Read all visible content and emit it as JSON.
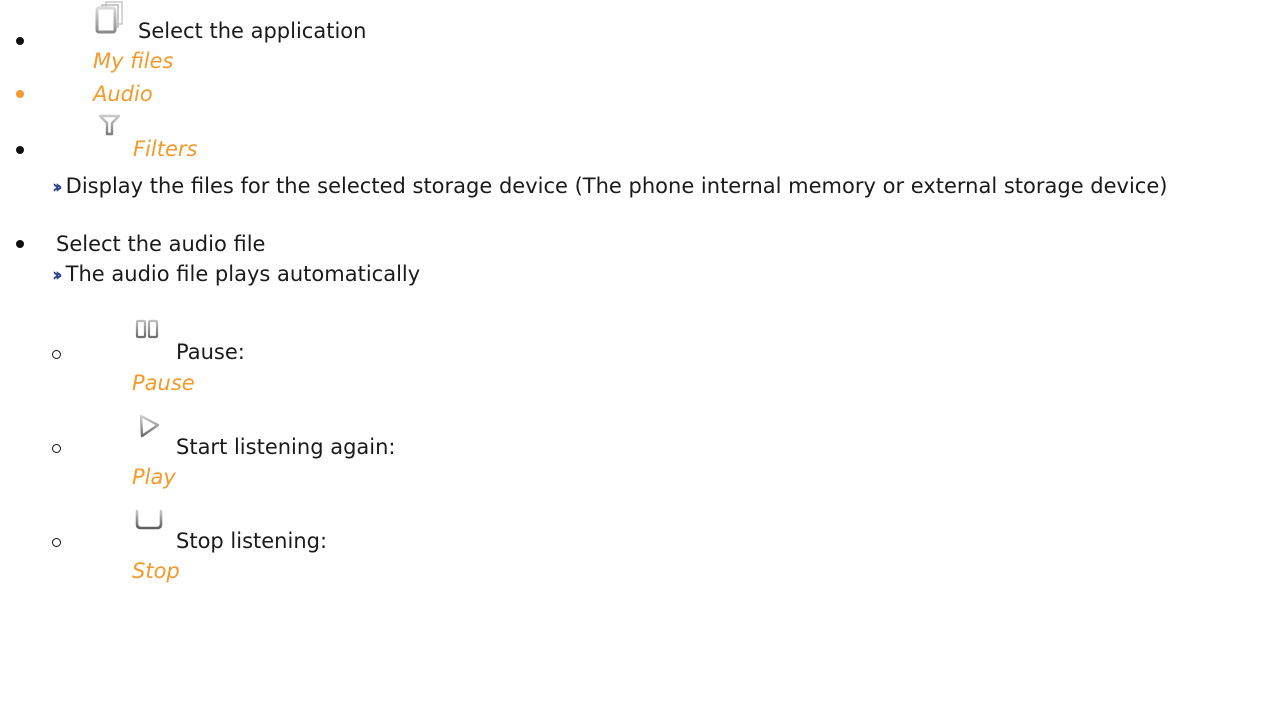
{
  "steps": {
    "select_app": "Select the application",
    "my_files": "My files",
    "audio": "Audio",
    "filters": "Filters",
    "filters_result": "Display the files for the selected storage device (The phone internal memory or external storage device)",
    "select_audio": "Select the audio file",
    "select_audio_result": "The audio file plays automatically"
  },
  "controls": [
    {
      "label": "Pause:",
      "key": "Pause",
      "icon": "pause-icon"
    },
    {
      "label": "Start listening again:",
      "key": "Play",
      "icon": "play-icon"
    },
    {
      "label": "Stop listening:",
      "key": "Stop",
      "icon": "stop-icon"
    }
  ],
  "colors": {
    "accent": "#f39a2b",
    "arrow": "#2d3e8c",
    "text": "#1a1a1a"
  }
}
